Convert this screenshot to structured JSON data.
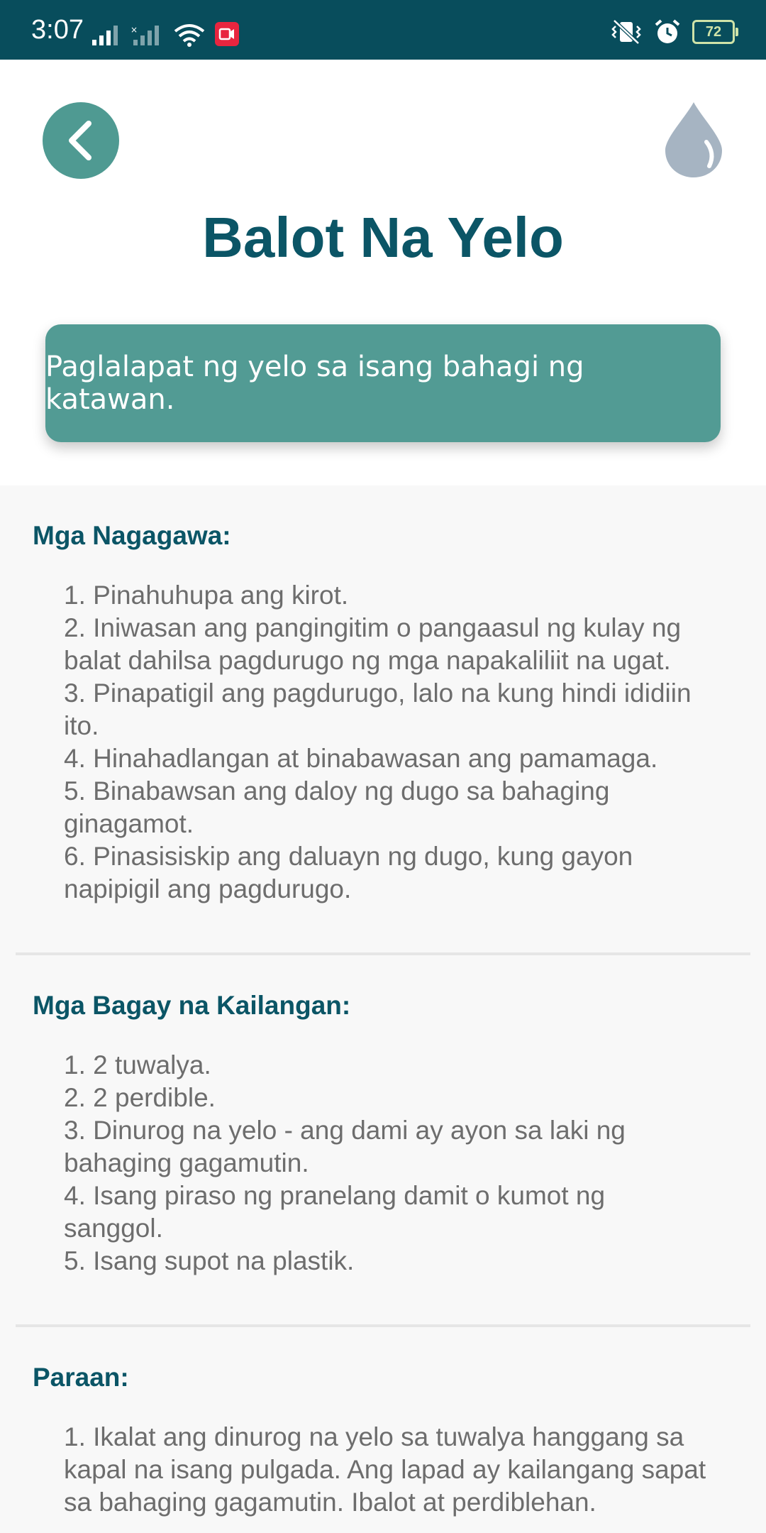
{
  "status_bar": {
    "time": "3:07",
    "battery_level": "72",
    "colors": {
      "background": "#084d5c"
    }
  },
  "header": {
    "title": "Balot Na Yelo",
    "summary": "Paglalapat ng yelo sa isang bahagi ng katawan.",
    "icons": {
      "back": "chevron-left-icon",
      "drop": "water-drop-icon"
    },
    "colors": {
      "accent": "#529b94",
      "title": "#0b5566",
      "drop": "#a6b4c2"
    }
  },
  "sections": [
    {
      "heading": "Mga Nagagawa:",
      "items": [
        "1. Pinahuhupa ang kirot.",
        "2. Iniwasan ang pangingitim o pangaasul ng kulay ng balat dahilsa pagdurugo ng mga napakaliliit na ugat.",
        "3. Pinapatigil ang pagdurugo, lalo na kung hindi ididiin ito.",
        "4. Hinahadlangan at binabawasan ang pamamaga.",
        "5. Binabawsan ang daloy ng dugo sa bahaging ginagamot.",
        "6. Pinasisiskip ang daluayn ng dugo, kung gayon napipigil ang pagdurugo."
      ]
    },
    {
      "heading": "Mga Bagay na Kailangan:",
      "items": [
        "1. 2 tuwalya.",
        "2. 2 perdible.",
        "3. Dinurog na yelo - ang dami ay ayon sa laki ng bahaging gagamutin.",
        "4. Isang piraso ng pranelang damit o kumot ng sanggol.",
        "5. Isang supot na plastik."
      ]
    },
    {
      "heading": "Paraan:",
      "items": [
        "1. Ikalat ang dinurog na yelo sa tuwalya hanggang sa kapal na isang pulgada. Ang lapad ay kailangang sapat sa bahaging gagamutin. Ibalot at perdiblehan."
      ]
    }
  ]
}
